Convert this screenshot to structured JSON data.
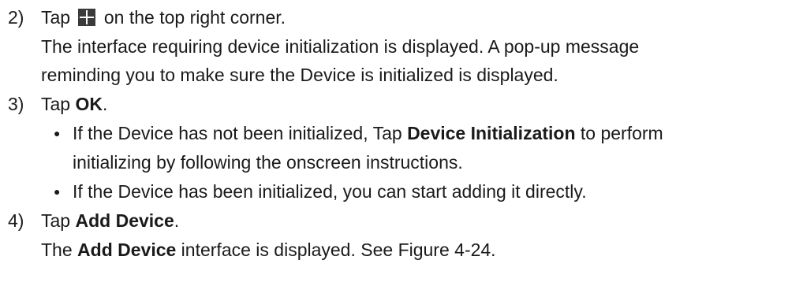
{
  "steps": [
    {
      "number": "2)",
      "pre": "Tap ",
      "icon": "plus-icon",
      "post": " on the top right corner.",
      "description": [
        "The interface requiring device initialization is displayed. A pop-up message",
        "reminding you to make sure the Device is initialized is displayed."
      ]
    },
    {
      "number": "3)",
      "pre": "Tap ",
      "bold": "OK",
      "post": ".",
      "bullets": [
        {
          "symbol": "●",
          "pre": "If the Device has not been initialized, Tap ",
          "bold": "Device Initialization",
          "post": " to perform",
          "continuation": "initializing by following the onscreen instructions."
        },
        {
          "symbol": "●",
          "text": "If the Device has been initialized, you can start adding it directly."
        }
      ]
    },
    {
      "number": "4)",
      "pre": "Tap ",
      "bold": "Add Device",
      "post": ".",
      "result": {
        "pre": "The ",
        "bold": "Add Device",
        "post": " interface is displayed. See Figure 4-24."
      }
    }
  ],
  "colors": {
    "text": "#1a1a1a",
    "icon_fill": "#3a3a3a",
    "icon_plus": "#ffffff"
  }
}
